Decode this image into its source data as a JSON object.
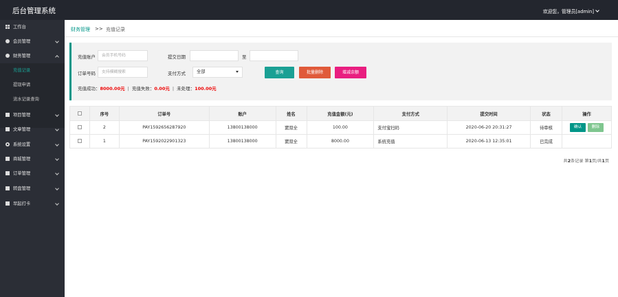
{
  "header": {
    "title": "后台管理系统",
    "welcome": "欢迎您，管理员[admin]"
  },
  "sidebar": {
    "items": [
      {
        "label": "工作台",
        "icon": "dashboard-icon"
      },
      {
        "label": "会员管理",
        "icon": "user-icon"
      },
      {
        "label": "财务管理",
        "icon": "finance-icon"
      },
      {
        "label": "项目管理",
        "icon": "project-icon"
      },
      {
        "label": "文章管理",
        "icon": "article-icon"
      },
      {
        "label": "系统设置",
        "icon": "gear-icon"
      },
      {
        "label": "商城管理",
        "icon": "shop-icon"
      },
      {
        "label": "订单管理",
        "icon": "order-icon"
      },
      {
        "label": "转盘管理",
        "icon": "wheel-icon"
      },
      {
        "label": "早起打卡",
        "icon": "checkin-icon"
      }
    ],
    "finance_sub": [
      "充值记录",
      "提现申请",
      "流水记录查询"
    ]
  },
  "breadcrumb": {
    "parent": "财务管理",
    "sep": ">>",
    "current": "充值记录"
  },
  "filters": {
    "account_label": "充值账户",
    "account_placeholder": "会员手机号码",
    "date_label": "提交日期",
    "date_to": "至",
    "order_label": "订单号码",
    "order_placeholder": "支持模糊搜索",
    "pay_label": "支付方式",
    "pay_selected": "全部",
    "search_btn": "查询",
    "batch_delete_btn": "批量删除",
    "add_balance_btn": "增减余额"
  },
  "summary": {
    "success_label": "充值成功：",
    "success": "8000.00元",
    "fail_label": "充值失败：",
    "fail": "0.00元",
    "pending_label": "未处理：",
    "pending": "100.00元",
    "sep": "|"
  },
  "table": {
    "headers": [
      "序号",
      "订单号",
      "账户",
      "姓名",
      "充值金额(元)",
      "支付方式",
      "提交时间",
      "状态",
      "操作"
    ],
    "rows": [
      {
        "no": "2",
        "order": "PAY1592656287920",
        "account": "13800138000",
        "name": "窦双全",
        "amount": "100.00",
        "method": "支付宝扫码",
        "time": "2020-06-20 20:31:27",
        "status": "待审核",
        "confirm": "确认",
        "delete": "删除"
      },
      {
        "no": "1",
        "order": "PAY1592022901323",
        "account": "13800138000",
        "name": "窦双全",
        "amount": "8000.00",
        "method": "系统充值",
        "time": "2020-06-13 12:35:01",
        "status": "已完成"
      }
    ]
  },
  "pager": {
    "prefix": "共",
    "total": "2",
    "mid": "条记录 第",
    "page": "1",
    "slash": "页/共",
    "pages": "1",
    "suffix": "页"
  },
  "colors": {
    "topbar": "#23262e",
    "sidebar": "#2b2e36",
    "accent": "#009688",
    "search": "#1aa094",
    "danger": "#e05a3a",
    "pink": "#e91e80",
    "confirm": "#009688",
    "delete": "#7fc68f"
  }
}
